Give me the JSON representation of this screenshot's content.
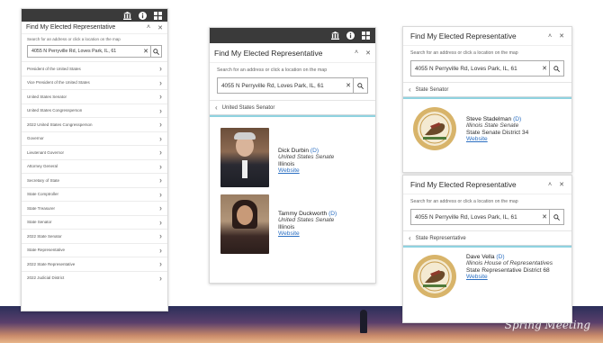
{
  "app": {
    "title": "Find My Elected Representative",
    "hint": "Search for an address or click a location on the map",
    "address": "4055 N Perryville Rd, Loves Park, IL, 61"
  },
  "icons": {
    "topbar": [
      "building-icon",
      "info-icon",
      "grid-icon"
    ],
    "collapse": "chevron-up-icon",
    "close": "close-icon",
    "clear": "clear-icon",
    "search": "search-icon",
    "back": "back-chevron-icon"
  },
  "panel1": {
    "items": [
      "President of the United States",
      "Vice President of the United States",
      "United States Senator",
      "United States Congressperson",
      "2022 United States Congressperson",
      "Governor",
      "Lieutenant Governor",
      "Attorney General",
      "Secretary of State",
      "State Comptroller",
      "State Treasurer",
      "State Senator",
      "2022 State Senator",
      "State Representative",
      "2022 State Representative",
      "2022 Judicial District"
    ]
  },
  "panel2": {
    "crumb": "United States Senator",
    "reps": [
      {
        "name": "Dick Durbin",
        "party": "(D)",
        "office": "United States Senate",
        "district": "Illinois",
        "link": "Website"
      },
      {
        "name": "Tammy Duckworth",
        "party": "(D)",
        "office": "United States Senate",
        "district": "Illinois",
        "link": "Website"
      }
    ]
  },
  "panel3": {
    "crumb": "State Senator",
    "rep": {
      "name": "Steve Stadelman",
      "party": "(D)",
      "office": "Illinois State Senate",
      "district": "State Senate District 34",
      "link": "Website"
    }
  },
  "panel4": {
    "crumb": "State Representative",
    "rep": {
      "name": "Dave Vella",
      "party": "(D)",
      "office": "Illinois House of Representatives",
      "district": "State Representative District 68",
      "link": "Website"
    }
  },
  "banner": {
    "brand": "Spring Meeting"
  }
}
